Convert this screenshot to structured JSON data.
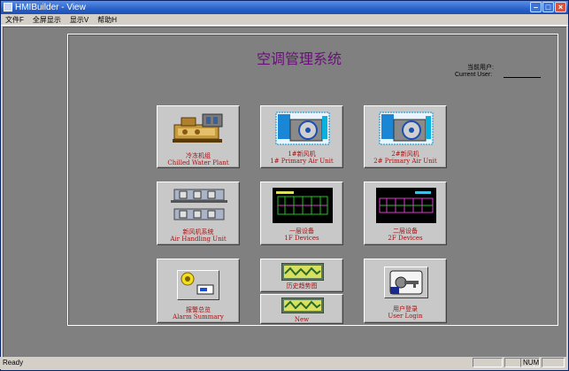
{
  "window": {
    "title": "HMIBuilder - View"
  },
  "menu": [
    "文件F",
    "全屏显示",
    "显示V",
    "帮助H"
  ],
  "header": {
    "system_title": "空调管理系统",
    "current_user_cn": "当前用户:",
    "current_user_en": "Current User:"
  },
  "tiles": {
    "chiller": {
      "cn": "冷冻机组",
      "en": "Chilled Water Plant"
    },
    "pau1": {
      "cn": "1#新风机",
      "en": "1# Primary Air Unit"
    },
    "pau2": {
      "cn": "2#新风机",
      "en": "2# Primary Air Unit"
    },
    "ahu": {
      "cn": "新风机系统",
      "en": "Air Handling Unit"
    },
    "floor1": {
      "cn": "一层设备",
      "en": "1F Devices"
    },
    "floor2": {
      "cn": "二层设备",
      "en": "2F Devices"
    },
    "alarm": {
      "cn": "报警总览",
      "en": "Alarm Summary"
    },
    "trend": {
      "cn": "历史趋势图"
    },
    "new_trend": {
      "en": "New"
    },
    "login": {
      "cn": "用户登录",
      "en": "User Login"
    }
  },
  "status": {
    "text": "Ready",
    "num": "NUM"
  }
}
